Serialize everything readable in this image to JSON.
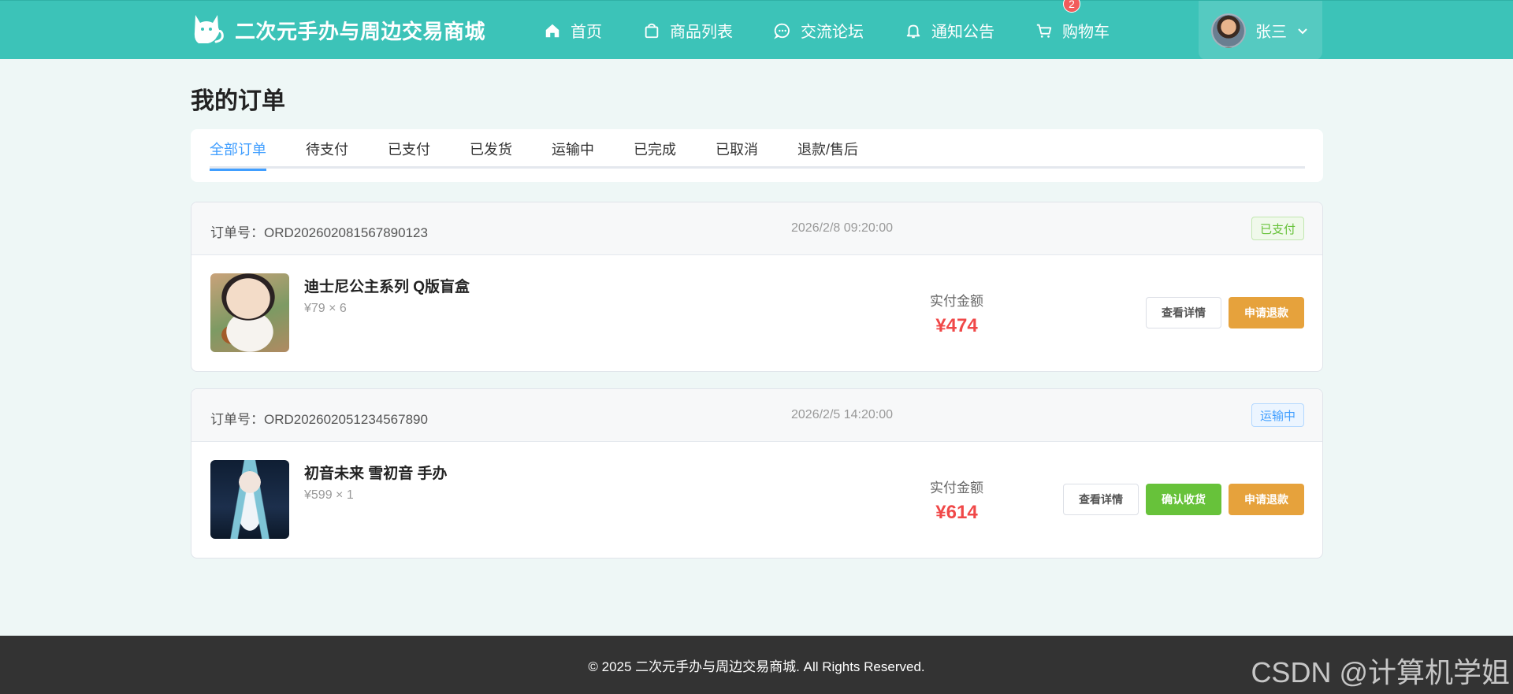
{
  "brand": {
    "title": "二次元手办与周边交易商城",
    "logo_icon": "cat-icon"
  },
  "nav": {
    "items": [
      {
        "label": "首页",
        "icon": "home-icon"
      },
      {
        "label": "商品列表",
        "icon": "bag-icon"
      },
      {
        "label": "交流论坛",
        "icon": "chat-icon"
      },
      {
        "label": "通知公告",
        "icon": "bell-icon"
      },
      {
        "label": "购物车",
        "icon": "cart-icon"
      }
    ],
    "cart_count": "2"
  },
  "user": {
    "name": "张三"
  },
  "page": {
    "title": "我的订单"
  },
  "tabs": [
    "全部订单",
    "待支付",
    "已支付",
    "已发货",
    "运输中",
    "已完成",
    "已取消",
    "退款/售后"
  ],
  "active_tab": "全部订单",
  "orders": [
    {
      "order_label": "订单号：ORD20260208156789012З",
      "time": "2026/2/8 09:20:00",
      "status": "已支付",
      "product": "迪士尼公主系列 Q版盲盒",
      "price_qty": "¥79 × 6",
      "paid_label": "实付金额",
      "amount": "¥474",
      "actions": [
        "查看详情",
        "申请退款"
      ]
    },
    {
      "order_label": "订单号：ORD20260205123456789­0",
      "time": "2026/2/5 14:20:00",
      "status": "运输中",
      "product": "初音未来 雪初音 手办",
      "price_qty": "¥599 × 1",
      "paid_label": "实付金额",
      "amount": "¥614",
      "actions": [
        "查看详情",
        "确认收货",
        "申请退款"
      ]
    }
  ],
  "footer": {
    "text": "© 2025 二次元手办与周边交易商城. All Rights Reserved."
  },
  "watermark": "CSDN @计算机学姐",
  "colors": {
    "header": "#3cc3b8",
    "price": "#f04848",
    "tab_active": "#409eff",
    "success": "#67c23a",
    "warning": "#e6a23c"
  }
}
